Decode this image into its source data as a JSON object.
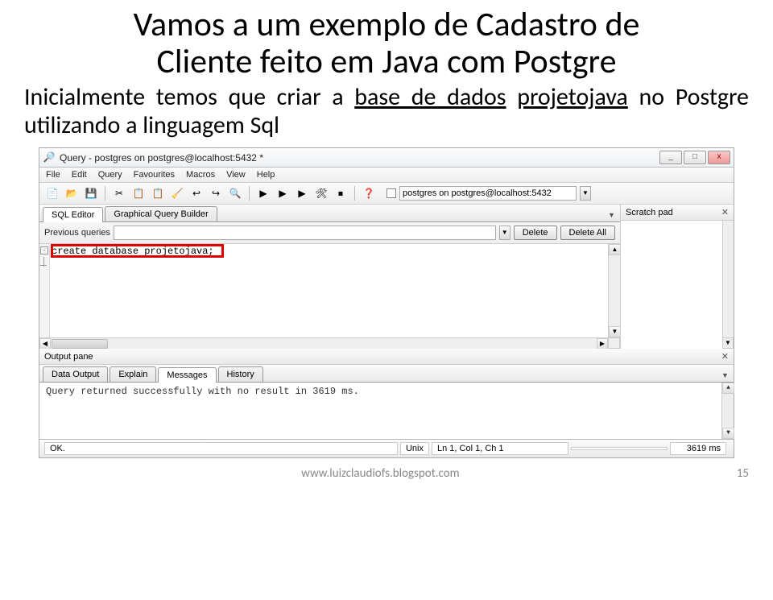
{
  "slide": {
    "title_l1": "Vamos a um exemplo de Cadastro de",
    "title_l2": "Cliente feito em Java com Postgre",
    "sub_pre": "Inicialmente temos que criar a ",
    "sub_u1": "base de dados",
    "sub_mid": " ",
    "sub_u2": "projetojava",
    "sub_post": " no Postgre utilizando a linguagem Sql"
  },
  "window": {
    "title": "Query - postgres on postgres@localhost:5432 *",
    "min": "_",
    "max": "□",
    "close": "x"
  },
  "menu": {
    "file": "File",
    "edit": "Edit",
    "query": "Query",
    "fav": "Favourites",
    "macros": "Macros",
    "view": "View",
    "help": "Help"
  },
  "toolbar": {
    "icons": [
      "📄",
      "📂",
      "💾",
      "✂",
      "📋",
      "📋",
      "🧹",
      "↩",
      "↪",
      "🔍",
      "▶",
      "▶",
      "▶",
      "🛠",
      "⏹",
      "❓"
    ],
    "combo_value": "postgres on postgres@localhost:5432"
  },
  "tabs": {
    "sql": "SQL Editor",
    "gqb": "Graphical Query Builder"
  },
  "prev": {
    "label": "Previous queries",
    "delete": "Delete",
    "deleteall": "Delete All"
  },
  "editor": {
    "code": "create database projetojava;"
  },
  "scratch": {
    "title": "Scratch pad"
  },
  "output": {
    "pane": "Output pane",
    "tabs": {
      "data": "Data Output",
      "explain": "Explain",
      "msg": "Messages",
      "hist": "History"
    },
    "message": "Query returned successfully with no result in 3619 ms."
  },
  "status": {
    "ok": "OK.",
    "os": "Unix",
    "pos": "Ln 1, Col 1, Ch 1",
    "time": "3619 ms"
  },
  "footer": {
    "url": "www.luizclaudiofs.blogspot.com",
    "page": "15"
  }
}
